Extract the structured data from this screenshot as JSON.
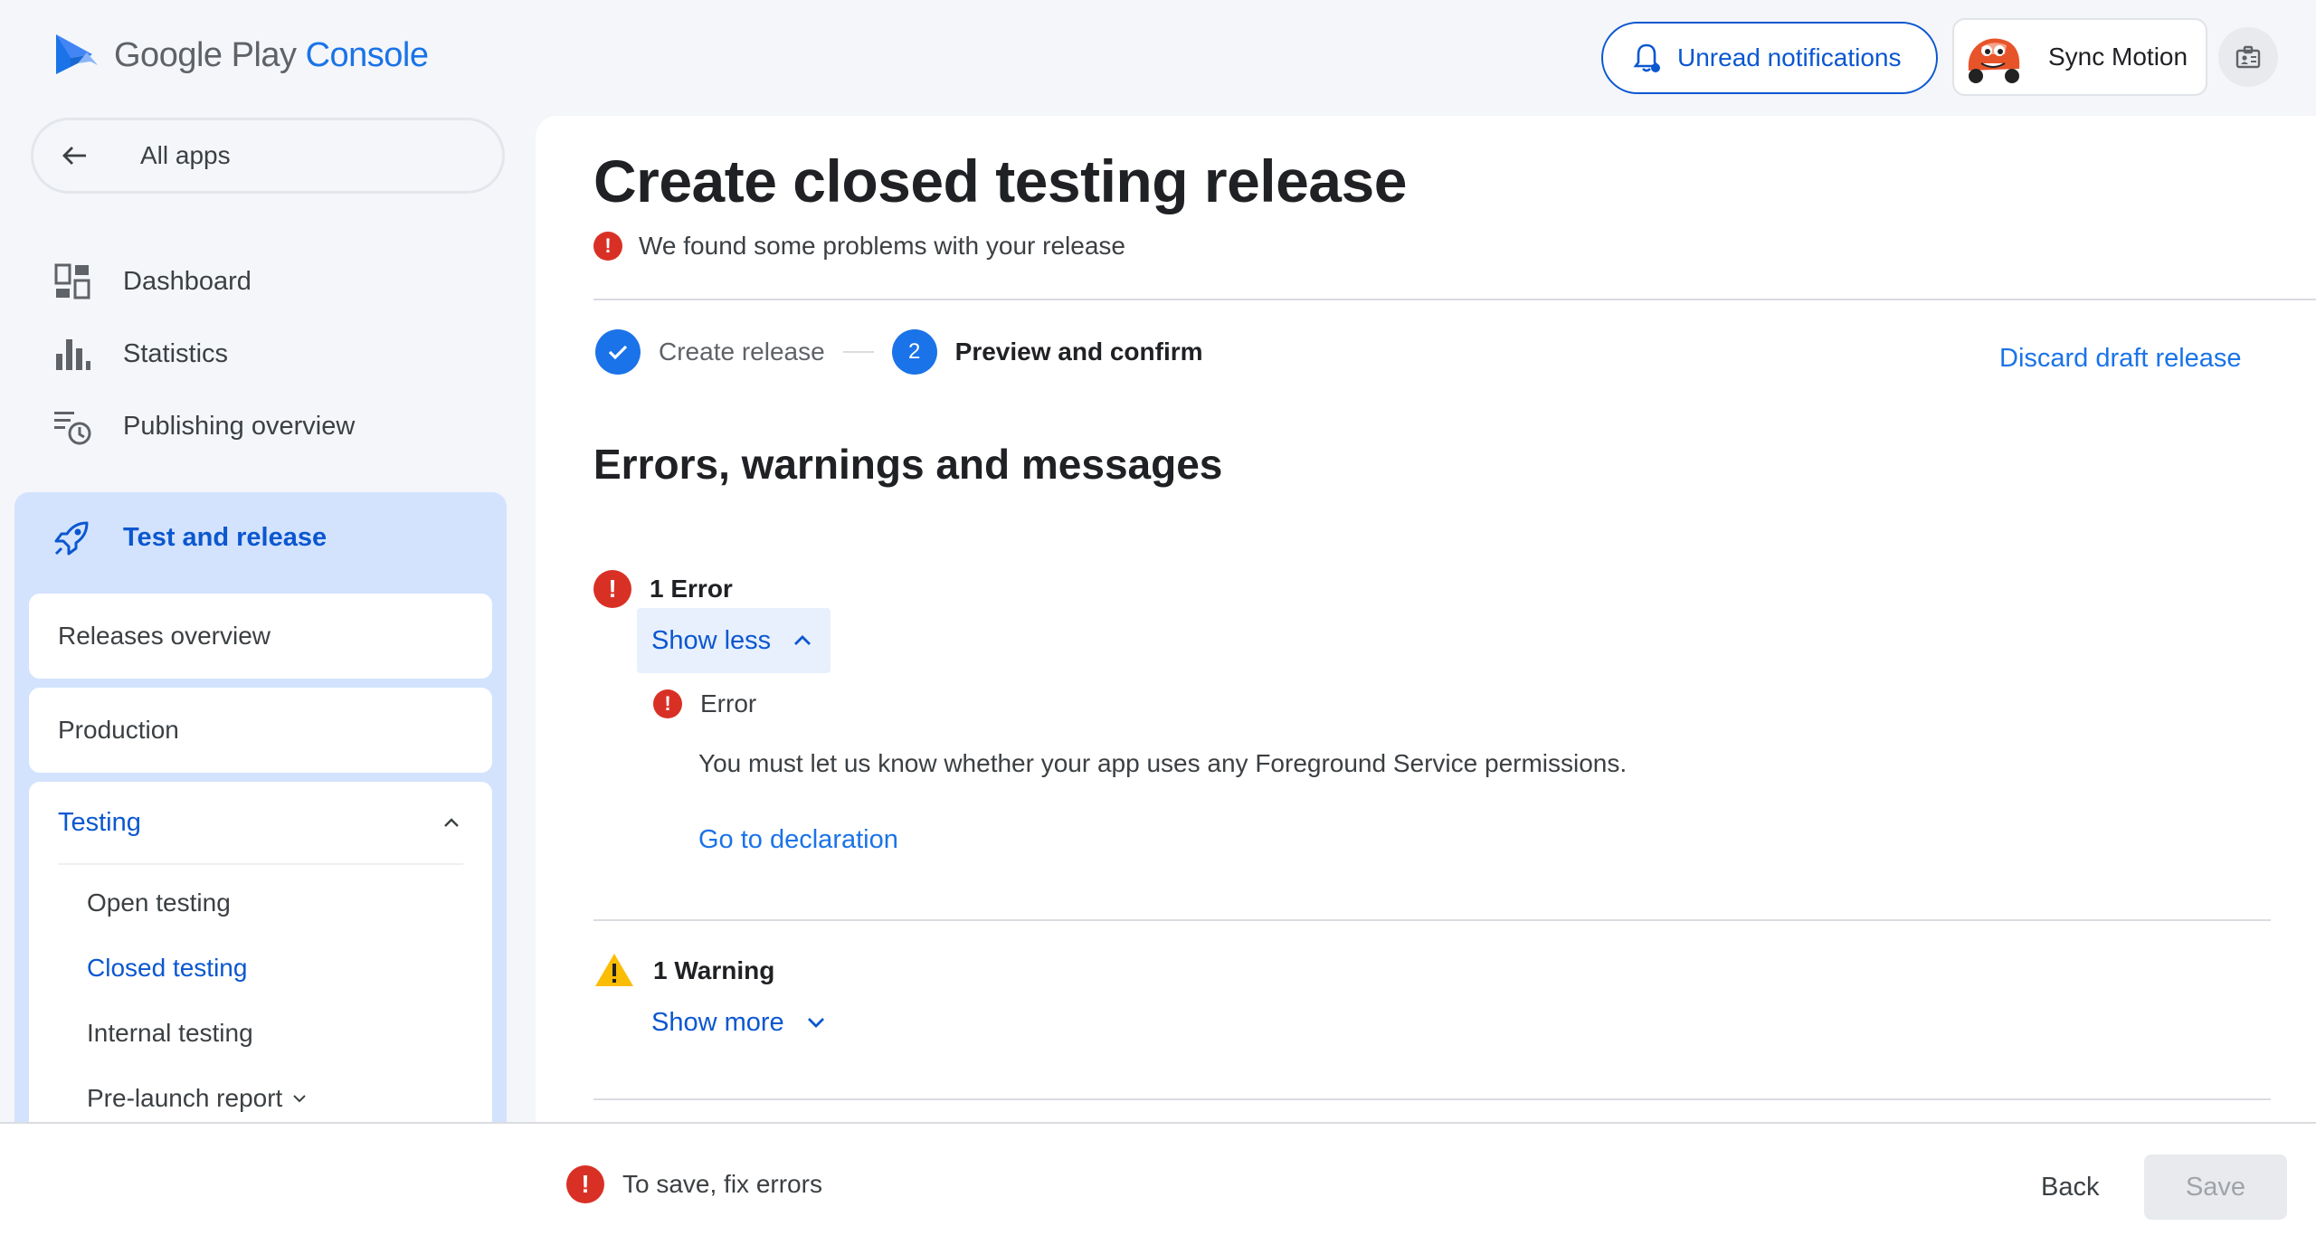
{
  "header": {
    "logo_brand": "Google Play",
    "logo_product": "Console",
    "notifications_label": "Unread notifications",
    "account_name": "Sync Motion"
  },
  "sidebar": {
    "all_apps": "All apps",
    "items": [
      {
        "label": "Dashboard",
        "icon": "dashboard-icon"
      },
      {
        "label": "Statistics",
        "icon": "bar-chart-icon"
      },
      {
        "label": "Publishing overview",
        "icon": "publishing-icon"
      }
    ],
    "section": {
      "label": "Test and release",
      "icon": "rocket-icon",
      "cards": [
        "Releases overview",
        "Production"
      ],
      "testing": {
        "label": "Testing",
        "sub_items": [
          "Open testing",
          "Closed testing",
          "Internal testing",
          "Pre-launch report"
        ],
        "active": "Closed testing"
      }
    }
  },
  "main": {
    "title": "Create closed testing release",
    "problem_text": "We found some problems with your release",
    "steps": [
      {
        "number": "1",
        "label": "Create release",
        "state": "done"
      },
      {
        "number": "2",
        "label": "Preview and confirm",
        "state": "current"
      }
    ],
    "discard_label": "Discard draft release",
    "section_title": "Errors, warnings and messages",
    "errors": {
      "heading": "1 Error",
      "toggle": "Show less",
      "item_title": "Error",
      "item_message": "You must let us know whether your app uses any Foreground Service permissions.",
      "item_link": "Go to declaration"
    },
    "warnings": {
      "heading": "1 Warning",
      "toggle": "Show more"
    }
  },
  "footer": {
    "save_message": "To save, fix errors",
    "back_label": "Back",
    "save_label": "Save"
  },
  "colors": {
    "accent": "#1a73e8",
    "error": "#d93025",
    "warning": "#fbbc04",
    "nav_section_bg": "#d3e3fd"
  }
}
